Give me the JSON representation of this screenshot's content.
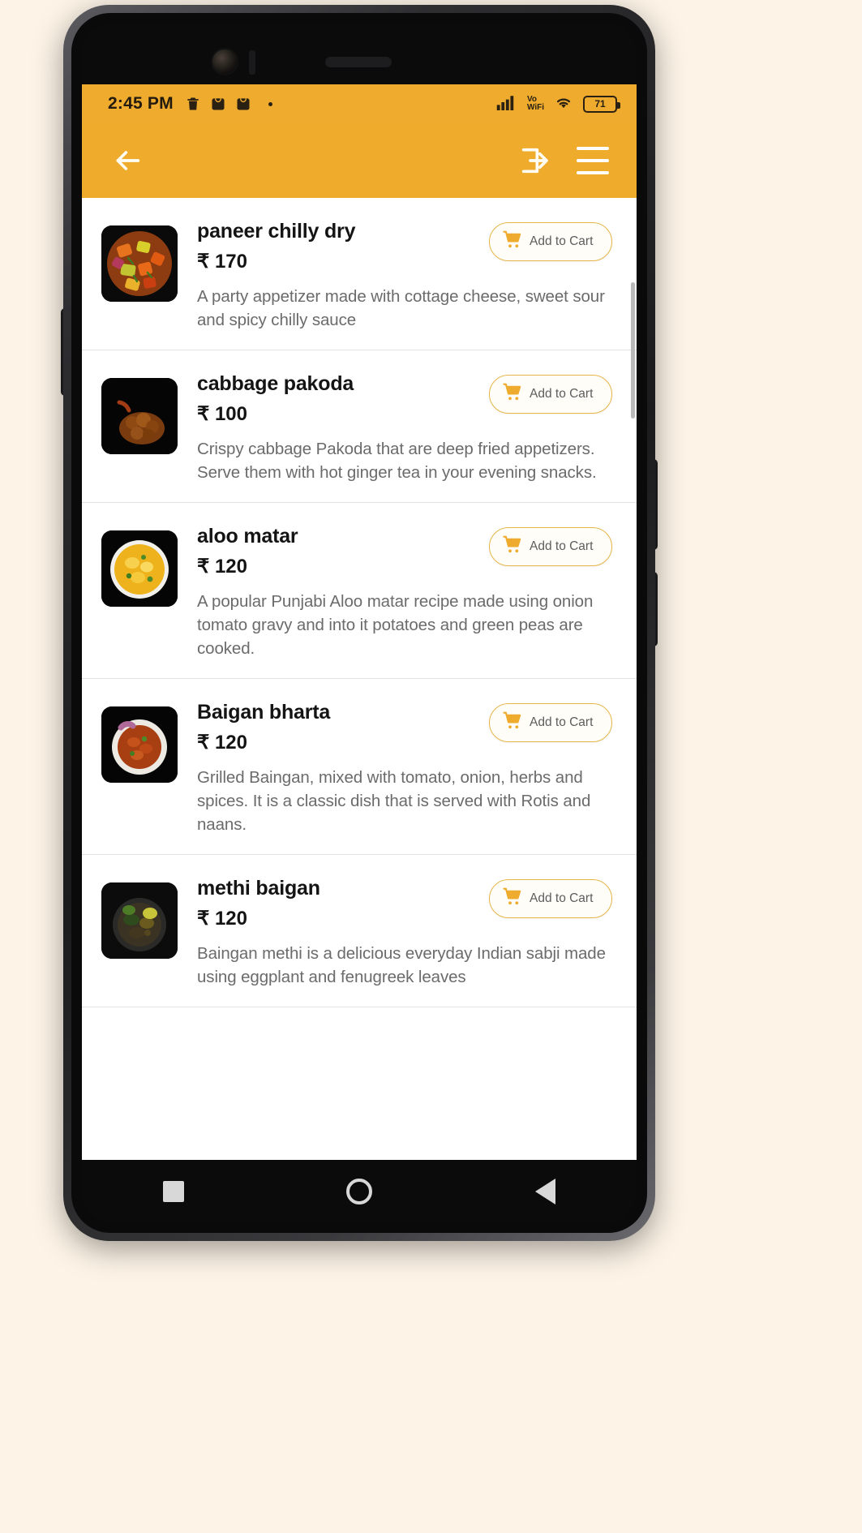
{
  "status_bar": {
    "time": "2:45 PM",
    "icons": [
      "trash-icon",
      "bag-icon",
      "bag-icon"
    ],
    "network_label_top": "Vo",
    "network_label_bottom": "WiFi",
    "battery_percent": "71",
    "signal_icon": "signal-bars-icon",
    "wifi_icon": "wifi-icon"
  },
  "app_bar": {
    "back_icon": "arrow-left-icon",
    "login_icon": "login-icon",
    "menu_icon": "hamburger-menu-icon",
    "background_color": "#efab2c"
  },
  "menu": {
    "add_to_cart_label": "Add to Cart",
    "currency": "₹",
    "items": [
      {
        "name": "paneer chilly dry",
        "price": "₹ 170",
        "description": "A party appetizer made with cottage cheese, sweet sour and spicy chilly sauce",
        "image": "paneer-chilly-dry-photo"
      },
      {
        "name": "cabbage pakoda",
        "price": "₹ 100",
        "description": "Crispy cabbage Pakoda that are deep fried appetizers. Serve them with hot ginger tea in your evening snacks.",
        "image": "cabbage-pakoda-photo"
      },
      {
        "name": "aloo matar",
        "price": "₹ 120",
        "description": "A popular Punjabi Aloo matar recipe made using onion tomato gravy and into it potatoes and green peas are cooked.",
        "image": "aloo-matar-photo"
      },
      {
        "name": "Baigan bharta",
        "price": "₹ 120",
        "description": "Grilled Baingan, mixed with tomato, onion, herbs and spices. It is a classic dish that is served with Rotis and naans.",
        "image": "baigan-bharta-photo"
      },
      {
        "name": "methi baigan",
        "price": "₹ 120",
        "description": "Baingan methi is a delicious everyday Indian sabji made using eggplant and fenugreek leaves",
        "image": "methi-baigan-photo"
      }
    ]
  },
  "nav_bar": {
    "recents_icon": "square-icon",
    "home_icon": "circle-icon",
    "back_icon": "triangle-back-icon"
  }
}
